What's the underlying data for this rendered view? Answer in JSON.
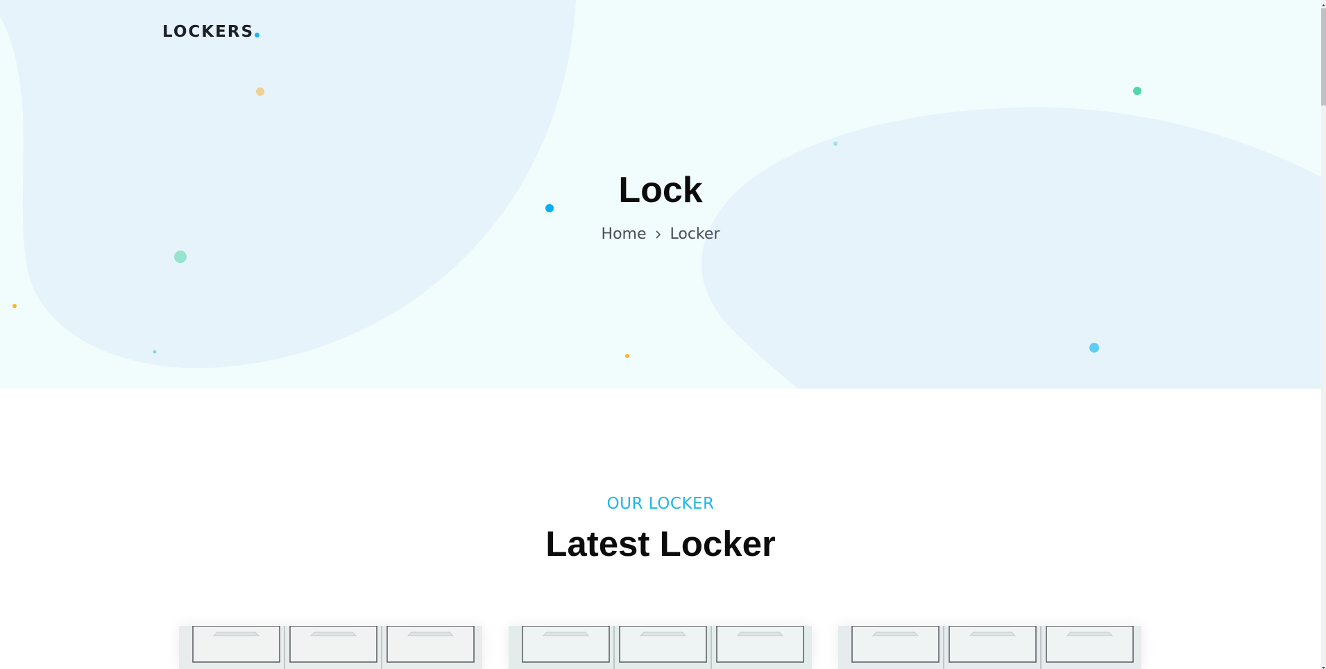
{
  "brand": {
    "logo_text": "LOCKERS",
    "accent_color": "#1fb6e6"
  },
  "hero": {
    "title": "Lock",
    "breadcrumb": {
      "home": "Home",
      "separator_icon": "chevron-right-icon",
      "current": "Locker"
    }
  },
  "section": {
    "eyebrow": "OUR LOCKER",
    "title": "Latest Locker"
  },
  "cards": [
    {
      "image": "locker-image"
    },
    {
      "image": "locker-image"
    },
    {
      "image": "locker-image"
    }
  ],
  "colors": {
    "hero_background": "#f1fcfd",
    "blob": "#e6f3fb",
    "heading": "#0c0c0c",
    "text": "#4a4d55"
  }
}
